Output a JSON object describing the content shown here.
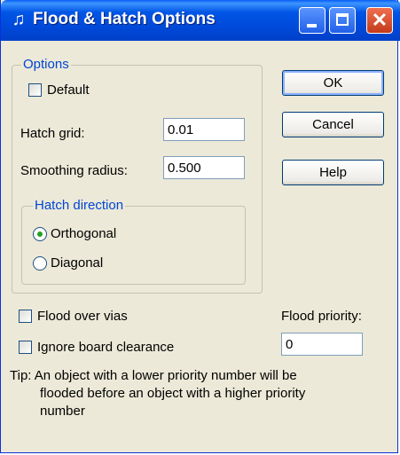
{
  "window": {
    "title": "Flood & Hatch Options",
    "icon": "flood-hatch-app-icon"
  },
  "options_group": {
    "legend": "Options",
    "default_label": "Default",
    "default_checked": false,
    "hatch_grid_label": "Hatch grid:",
    "hatch_grid_value": "0.01",
    "smoothing_label": "Smoothing radius:",
    "smoothing_value": "0.500"
  },
  "hatch_direction": {
    "legend": "Hatch direction",
    "orthogonal_label": "Orthogonal",
    "diagonal_label": "Diagonal",
    "selected": "Orthogonal"
  },
  "buttons": {
    "ok": "OK",
    "cancel": "Cancel",
    "help": "Help"
  },
  "flood_over_vias_label": "Flood over vias",
  "ignore_clearance_label": "Ignore board clearance",
  "flood_priority_label": "Flood priority:",
  "flood_priority_value": "0",
  "tip_line1": "Tip: An object with a lower priority number will be",
  "tip_line2": "flooded before an object with a higher priority",
  "tip_line3": "number"
}
